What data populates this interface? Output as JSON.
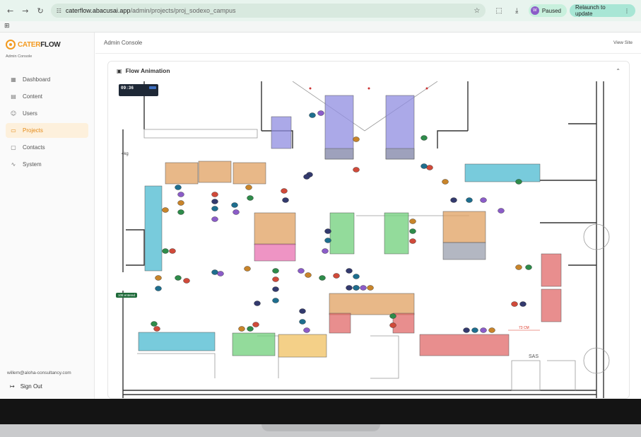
{
  "browser": {
    "url_host": "caterflow.abacusai.app",
    "url_path": "/admin/projects/proj_sodexo_campus",
    "profile_initial": "W",
    "paused_label": "Paused",
    "relaunch_label": "Relaunch to update",
    "icons": [
      "back-arrow-icon",
      "forward-arrow-icon",
      "reload-icon",
      "site-info-icon",
      "bookmark-star-icon",
      "extensions-icon",
      "download-icon",
      "apps-grid-icon",
      "kebab-menu-icon"
    ]
  },
  "sidebar": {
    "logo_cater": "CATER",
    "logo_flow": "FLOW",
    "subtitle": "Admin Console",
    "items": [
      {
        "label": "Dashboard",
        "icon": "dashboard-icon",
        "active": false
      },
      {
        "label": "Content",
        "icon": "document-icon",
        "active": false
      },
      {
        "label": "Users",
        "icon": "users-icon",
        "active": false
      },
      {
        "label": "Projects",
        "icon": "folder-icon",
        "active": true
      },
      {
        "label": "Contacts",
        "icon": "chat-icon",
        "active": false
      },
      {
        "label": "System",
        "icon": "activity-icon",
        "active": false
      }
    ],
    "user_email": "willem@aloha-consultancy.com",
    "signout_label": "Sign Out"
  },
  "topbar": {
    "title": "Admin Console",
    "view_site": "View Site"
  },
  "card": {
    "title": "Flow Animation",
    "icon": "film-icon",
    "collapse_icon": "chevron-up-icon"
  },
  "animation": {
    "clock": "09:36",
    "entered_badge": "108 entered",
    "distance_label": "73 CM",
    "room_label": "SAS",
    "label_4kg": "4kg"
  },
  "colors": {
    "accent": "#f39a1f",
    "station_purple": "#8f8ce0",
    "station_orange": "#e0a060",
    "station_teal": "#4bbad0",
    "station_green": "#6fcf7a",
    "station_pink": "#e870b0",
    "station_red": "#e06868",
    "station_grey": "#9a9fae",
    "station_yellow": "#f0c060"
  }
}
